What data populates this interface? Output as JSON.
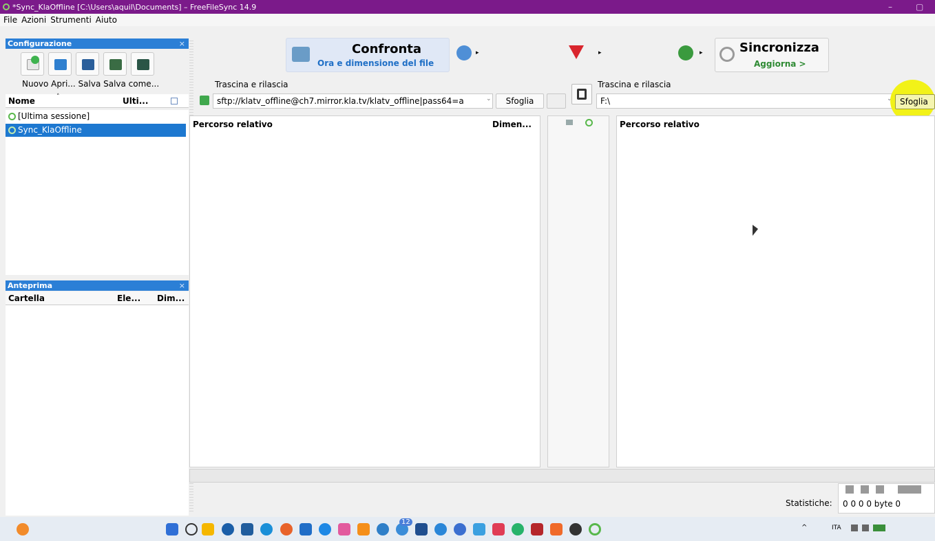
{
  "window": {
    "title": "*Sync_KlaOffline [C:\\Users\\aquil\\Documents] – FreeFileSync 14.9",
    "minimize": "–",
    "maximize": "▢"
  },
  "menu": [
    "File",
    "Azioni",
    "Strumenti",
    "Aiuto"
  ],
  "config_panel": {
    "title": "Configurazione",
    "close": "×",
    "tool_labels": "Nuovo Apri... Salva Salva come...",
    "col_name": "Nome",
    "col_last": "Ulti...",
    "sessions": [
      "[Ultima sessione]",
      "Sync_KlaOffline"
    ]
  },
  "preview_panel": {
    "title": "Anteprima",
    "close": "×",
    "col_folder": "Cartella",
    "col_items": "Ele...",
    "col_size": "Dim..."
  },
  "toolbar": {
    "compare_label": "Confronta",
    "compare_sub": "Ora e dimensione del file",
    "sync_label": "Sincronizza",
    "sync_sub": "Aggiorna >"
  },
  "left_folder": {
    "drop_hint": "Trascina e rilascia",
    "path": "sftp://klatv_offline@ch7.mirror.kla.tv/klatv_offline|pass64=a",
    "browse": "Sfoglia"
  },
  "right_folder": {
    "drop_hint": "Trascina e rilascia",
    "path": "F:\\",
    "browse": "Sfoglia"
  },
  "grid": {
    "left_col_path": "Percorso relativo",
    "left_col_size": "Dimen...",
    "right_col_path": "Percorso relativo"
  },
  "status": {
    "stats_label": "Statistiche:",
    "stats_values": "0  0  0  0 byte  0"
  },
  "taskbar": {
    "notification_count": "12",
    "lang": "ITA"
  },
  "colors": {
    "titlebar": "#7b1a8a",
    "selection": "#1d78d0",
    "highlight": "#f2f200"
  }
}
